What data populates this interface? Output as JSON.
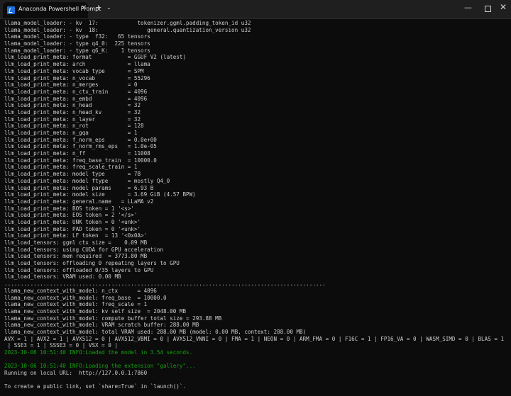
{
  "window": {
    "tab_title": "Anaconda Powershell Prompt",
    "tab_close": "✕",
    "new_tab": "+",
    "tab_menu": "⌄",
    "minimize": "—",
    "maximize": "",
    "close": "✕",
    "accent_color": "#1e6fd9"
  },
  "terminal": {
    "default_color": "#cccccc",
    "info_color": "#13a10e",
    "lines": [
      {
        "text": "llama_model_loader: - kv  17:            tokenizer.ggml.padding_token_id u32",
        "style": "normal"
      },
      {
        "text": "llama_model_loader: - kv  18:               general.quantization_version u32",
        "style": "normal"
      },
      {
        "text": "llama_model_loader: - type  f32:   65 tensors",
        "style": "normal"
      },
      {
        "text": "llama_model_loader: - type q4_0:  225 tensors",
        "style": "normal"
      },
      {
        "text": "llama_model_loader: - type q6_K:    1 tensors",
        "style": "normal"
      },
      {
        "text": "llm_load_print_meta: format           = GGUF V2 (latest)",
        "style": "normal"
      },
      {
        "text": "llm_load_print_meta: arch             = llama",
        "style": "normal"
      },
      {
        "text": "llm_load_print_meta: vocab type       = SPM",
        "style": "normal"
      },
      {
        "text": "llm_load_print_meta: n_vocab          = 55296",
        "style": "normal"
      },
      {
        "text": "llm_load_print_meta: n_merges         = 0",
        "style": "normal"
      },
      {
        "text": "llm_load_print_meta: n_ctx_train      = 4096",
        "style": "normal"
      },
      {
        "text": "llm_load_print_meta: n_embd           = 4096",
        "style": "normal"
      },
      {
        "text": "llm_load_print_meta: n_head           = 32",
        "style": "normal"
      },
      {
        "text": "llm_load_print_meta: n_head_kv        = 32",
        "style": "normal"
      },
      {
        "text": "llm_load_print_meta: n_layer          = 32",
        "style": "normal"
      },
      {
        "text": "llm_load_print_meta: n_rot            = 128",
        "style": "normal"
      },
      {
        "text": "llm_load_print_meta: n_gqa            = 1",
        "style": "normal"
      },
      {
        "text": "llm_load_print_meta: f_norm_eps       = 0.0e+00",
        "style": "normal"
      },
      {
        "text": "llm_load_print_meta: f_norm_rms_eps   = 1.0e-05",
        "style": "normal"
      },
      {
        "text": "llm_load_print_meta: n_ff             = 11008",
        "style": "normal"
      },
      {
        "text": "llm_load_print_meta: freq_base_train  = 10000.0",
        "style": "normal"
      },
      {
        "text": "llm_load_print_meta: freq_scale_train = 1",
        "style": "normal"
      },
      {
        "text": "llm_load_print_meta: model type       = 7B",
        "style": "normal"
      },
      {
        "text": "llm_load_print_meta: model ftype      = mostly Q4_0",
        "style": "normal"
      },
      {
        "text": "llm_load_print_meta: model params     = 6.93 B",
        "style": "normal"
      },
      {
        "text": "llm_load_print_meta: model size       = 3.69 GiB (4.57 BPW)",
        "style": "normal"
      },
      {
        "text": "llm_load_print_meta: general.name   = LLaMA v2",
        "style": "normal"
      },
      {
        "text": "llm_load_print_meta: BOS token = 1 '<s>'",
        "style": "normal"
      },
      {
        "text": "llm_load_print_meta: EOS token = 2 '</s>'",
        "style": "normal"
      },
      {
        "text": "llm_load_print_meta: UNK token = 0 '<unk>'",
        "style": "normal"
      },
      {
        "text": "llm_load_print_meta: PAD token = 0 '<unk>'",
        "style": "normal"
      },
      {
        "text": "llm_load_print_meta: LF token  = 13 '<0x0A>'",
        "style": "normal"
      },
      {
        "text": "llm_load_tensors: ggml ctx size =    0.09 MB",
        "style": "normal"
      },
      {
        "text": "llm_load_tensors: using CUDA for GPU acceleration",
        "style": "normal"
      },
      {
        "text": "llm_load_tensors: mem required  = 3773.80 MB",
        "style": "normal"
      },
      {
        "text": "llm_load_tensors: offloading 0 repeating layers to GPU",
        "style": "normal"
      },
      {
        "text": "llm_load_tensors: offloaded 0/35 layers to GPU",
        "style": "normal"
      },
      {
        "text": "llm_load_tensors: VRAM used: 0.00 MB",
        "style": "normal"
      },
      {
        "text": "...................................................................................................",
        "style": "normal"
      },
      {
        "text": "llama_new_context_with_model: n_ctx      = 4096",
        "style": "normal"
      },
      {
        "text": "llama_new_context_with_model: freq_base  = 10000.0",
        "style": "normal"
      },
      {
        "text": "llama_new_context_with_model: freq_scale = 1",
        "style": "normal"
      },
      {
        "text": "llama_new_context_with_model: kv self size  = 2048.00 MB",
        "style": "normal"
      },
      {
        "text": "llama_new_context_with_model: compute buffer total size = 293.88 MB",
        "style": "normal"
      },
      {
        "text": "llama_new_context_with_model: VRAM scratch buffer: 288.00 MB",
        "style": "normal"
      },
      {
        "text": "llama_new_context_with_model: total VRAM used: 288.00 MB (model: 0.00 MB, context: 288.00 MB)",
        "style": "normal"
      },
      {
        "text": "AVX = 1 | AVX2 = 1 | AVX512 = 0 | AVX512_VBMI = 0 | AVX512_VNNI = 0 | FMA = 1 | NEON = 0 | ARM_FMA = 0 | F16C = 1 | FP16_VA = 0 | WASM_SIMD = 0 | BLAS = 1",
        "style": "normal"
      },
      {
        "text": " | SSE3 = 1 | SSSE3 = 0 | VSX = 0 |",
        "style": "normal"
      },
      {
        "text": "2023-10-06 10:51:40 INFO:Loaded the model in 3.54 seconds.",
        "style": "info"
      },
      {
        "text": "",
        "style": "normal"
      },
      {
        "text": "2023-10-06 10:51:40 INFO:Loading the extension \"gallery\"...",
        "style": "info"
      },
      {
        "text": "Running on local URL:  http://127.0.0.1:7860",
        "style": "normal"
      },
      {
        "text": "",
        "style": "normal"
      },
      {
        "text": "To create a public link, set `share=True` in `launch()`.",
        "style": "normal"
      }
    ]
  }
}
